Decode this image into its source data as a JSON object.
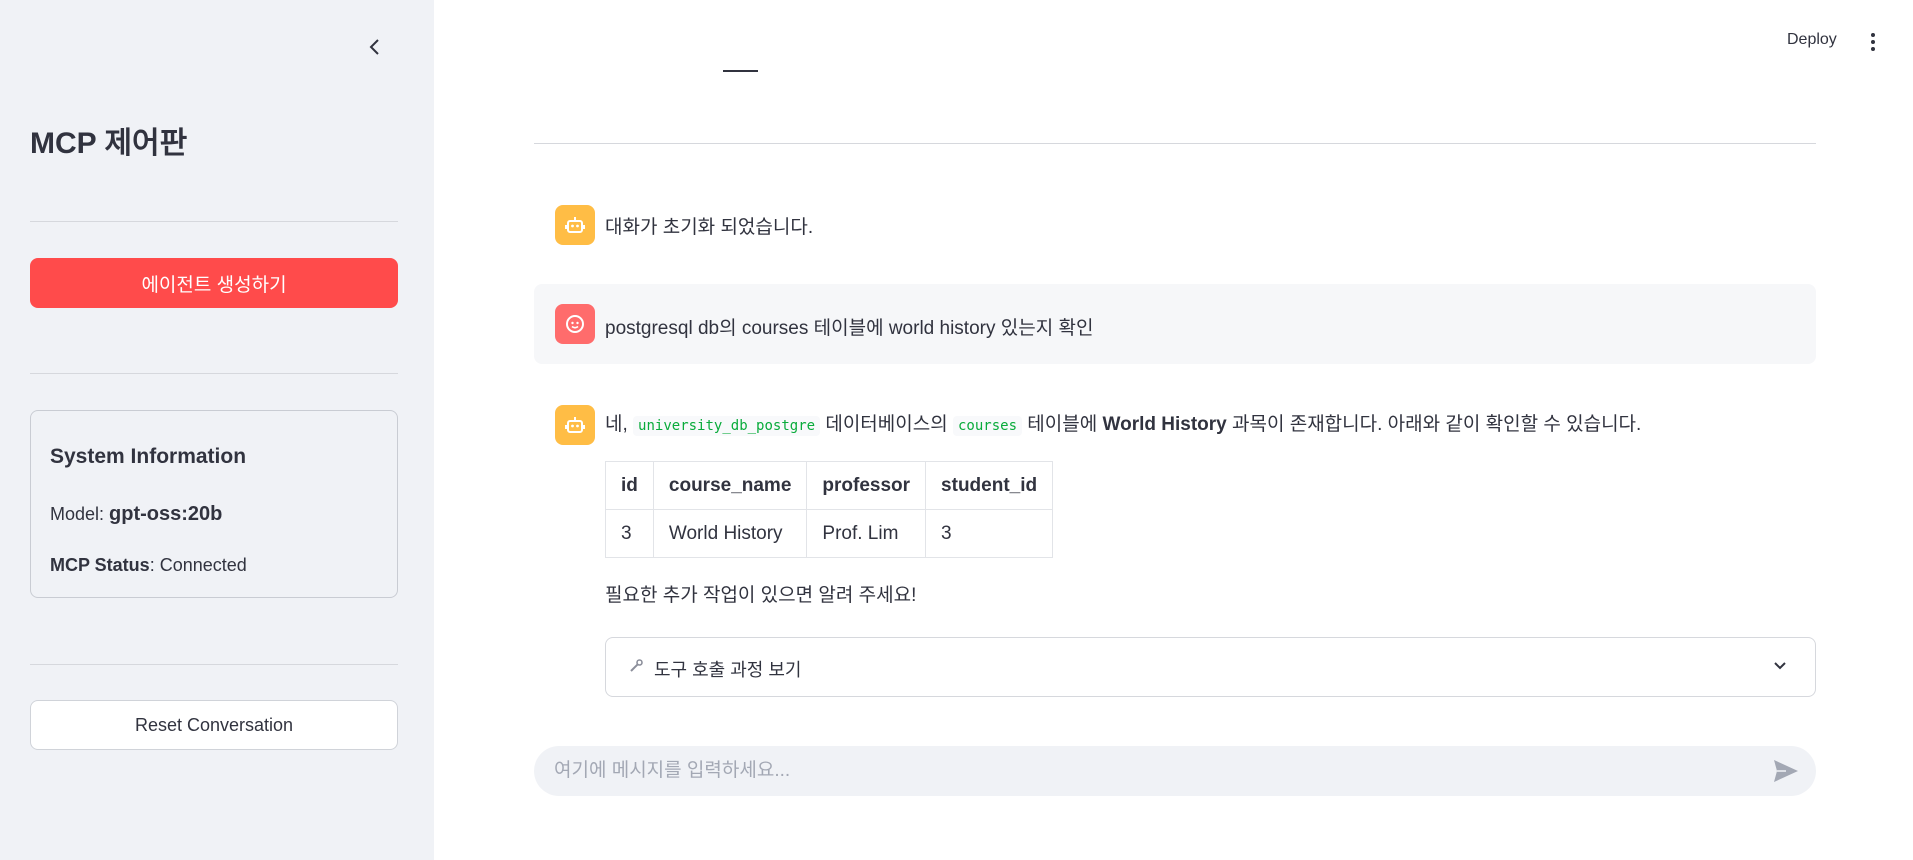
{
  "sidebar": {
    "title": "MCP 제어판",
    "create_agent_label": "에이전트 생성하기",
    "system_info": {
      "title": "System Information",
      "model_label": "Model:",
      "model_value": "gpt-oss:20b",
      "mcp_status_label": "MCP Status",
      "mcp_status_value": ": Connected"
    },
    "reset_label": "Reset Conversation"
  },
  "header": {
    "deploy_label": "Deploy"
  },
  "messages": [
    {
      "role": "assistant",
      "text": "대화가 초기화 되었습니다."
    },
    {
      "role": "user",
      "text": "postgresql db의 courses 테이블에 world history 있는지 확인"
    },
    {
      "role": "assistant",
      "intro_1": "네,",
      "code_1": "university_db_postgre",
      "intro_2": "데이터베이스의",
      "code_2": "courses",
      "intro_3": "테이블에",
      "bold": "World History",
      "intro_4": "과목이 존재합니다. 아래와 같이 확인할 수 있습니다.",
      "table": {
        "headers": [
          "id",
          "course_name",
          "professor",
          "student_id"
        ],
        "rows": [
          [
            "3",
            "World History",
            "Prof. Lim",
            "3"
          ]
        ]
      },
      "followup": "필요한 추가 작업이 있으면 알려 주세요!",
      "expander_icon": "wrench-icon",
      "expander_label": "도구 호출 과정 보기"
    }
  ],
  "chat_input": {
    "placeholder": "여기에 메시지를 입력하세요..."
  },
  "colors": {
    "primary": "#ff4b4b",
    "sidebar_bg": "#f0f2f6",
    "bot_avatar": "#ffbd45",
    "user_avatar": "#ff6c6c",
    "code_text": "#09ab3b"
  }
}
